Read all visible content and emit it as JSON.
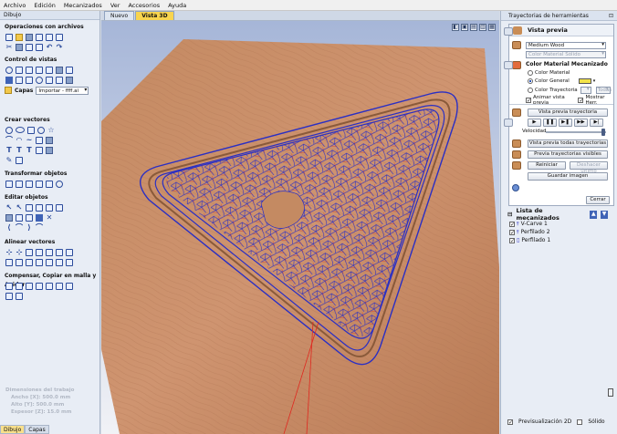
{
  "menu": [
    "Archivo",
    "Edición",
    "Mecanizados",
    "Ver",
    "Accesorios",
    "Ayuda"
  ],
  "left": {
    "panel_title": "Dibujo",
    "sections": {
      "file_ops": "Operaciones con archivos",
      "view_control": "Control de vistas",
      "create_vectors": "Crear vectores",
      "transform": "Transformar objetos",
      "edit": "Editar objetos",
      "align": "Alinear vectores",
      "offset": "Compensar, Copiar en malla y Anidar"
    },
    "layers_label": "Capas",
    "layers_value": "Importar - ffff.ai",
    "job": {
      "header": "Dimensiones del trabajo",
      "width": "Ancho   [X]: 500.0 mm",
      "height": "Alto    [Y]: 500.0 mm",
      "thickness": "Espesor [Z]: 15.0 mm"
    },
    "tabs": [
      "Dibujo",
      "Capas"
    ]
  },
  "viewport": {
    "tabs": [
      "Nuevo",
      "Vista 3D"
    ],
    "active_tab": "Vista 3D"
  },
  "right": {
    "panel_title": "Trayectorias de herramientas",
    "preview_title": "Vista previa",
    "material": "Medium Wood",
    "solid_color_label": "Color Material Sólido",
    "machined_color_title": "Color Material Mecanizado",
    "radio_material": "Color Material",
    "radio_general": "Color General",
    "radio_toolpath": "Color Trayectoria",
    "todas": "Todas",
    "animate": "Animar vista previa",
    "show_tool": "Mostrar Herr.",
    "preview_toolpath_btn": "Vista previa trayectoria",
    "speed_label": "Velocidad",
    "preview_all_btn": "Vista previa todas trayectorias",
    "preview_visible_btn": "Previa trayectorias visibles",
    "reset_btn": "Reiniciar",
    "undo_last_btn": "Deshacer último",
    "save_image_btn": "Guardar imagen",
    "close_btn": "Cerrar",
    "machining_list_title": "Lista de mecanizados",
    "toolpaths": [
      "V-Carve 1",
      "Perfilado 2",
      "Perfilado 1"
    ],
    "preview_2d": "Previsualización 2D",
    "solid": "Sólido"
  }
}
